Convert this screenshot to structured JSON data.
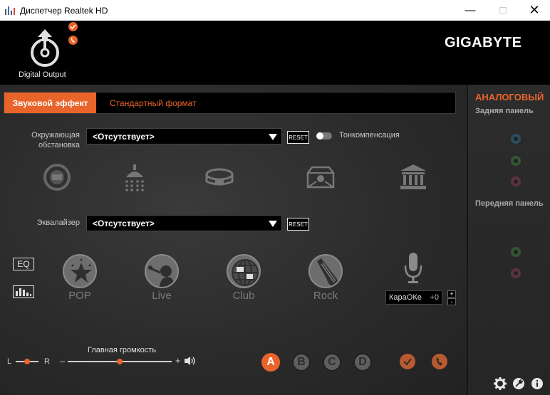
{
  "window": {
    "title": "Диспетчер Realtek HD",
    "minimize_icon": "minimize-icon",
    "maximize_icon": "maximize-icon",
    "close_icon": "close-icon"
  },
  "header": {
    "device_label": "Digital Output",
    "brand": "GIGABYTE",
    "accent_color": "#e8642a"
  },
  "tabs": [
    {
      "label": "Звуковой эффект",
      "active": true
    },
    {
      "label": "Стандартный формат",
      "active": false
    }
  ],
  "environment": {
    "label": "Окружающая обстановка",
    "selected": "<Отсутствует>",
    "reset_label": "RESET",
    "toggle_label": "Тонкомпенсация",
    "toggle_on": false,
    "icons": [
      "stone-corridor-icon",
      "shower-icon",
      "arena-icon",
      "room-icon",
      "auditorium-icon"
    ]
  },
  "equalizer": {
    "label": "Эквалайзер",
    "selected": "<Отсутствует>",
    "reset_label": "RESET",
    "eq_button": "EQ",
    "presets": [
      {
        "name": "POP",
        "icon": "star-icon"
      },
      {
        "name": "Live",
        "icon": "singer-icon"
      },
      {
        "name": "Club",
        "icon": "disco-ball-icon"
      },
      {
        "name": "Rock",
        "icon": "guitar-icon"
      }
    ],
    "karaoke": {
      "label": "КараОКе",
      "value": "+0",
      "plus": "+",
      "minus": "-"
    }
  },
  "volume": {
    "label": "Главная громкость",
    "left": "L",
    "right": "R",
    "minus": "–",
    "plus": "+",
    "balance_level": 0.5,
    "volume_level": 0.5
  },
  "profiles": [
    "A",
    "B",
    "C",
    "D"
  ],
  "active_profile": "A",
  "right_panel": {
    "title": "АНАЛОГОВЫЙ",
    "rear_label": "Задняя панель",
    "front_label": "Передняя панель"
  }
}
